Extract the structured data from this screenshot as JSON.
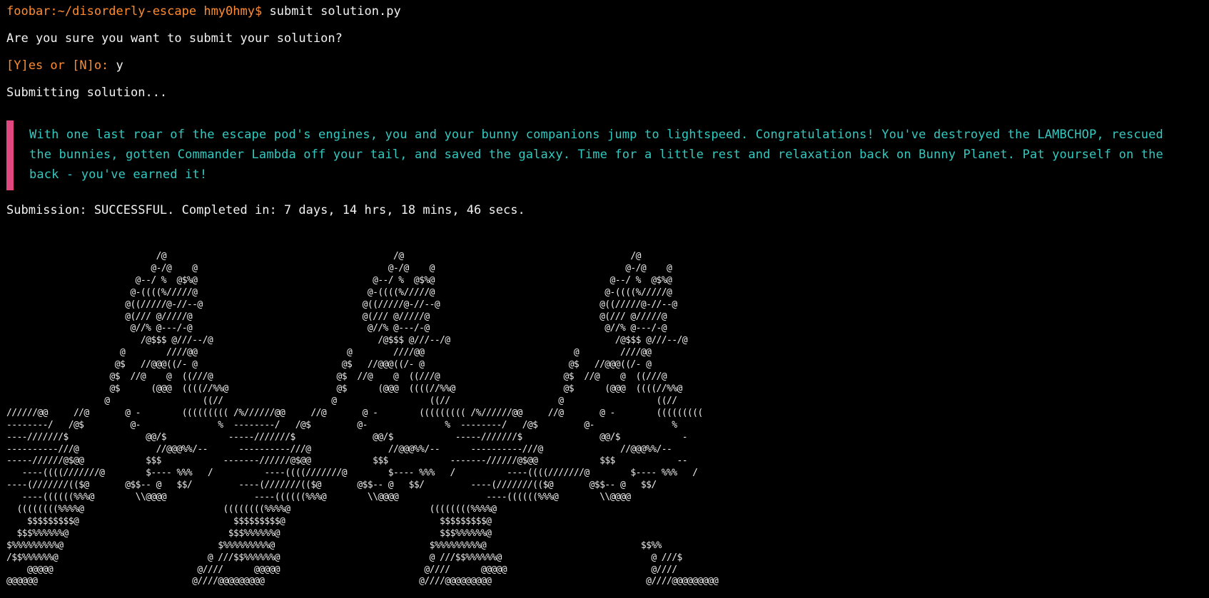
{
  "terminal": {
    "prompt_host_path": "foobar:~/disorderly-escape hmy0hmy$",
    "command": " submit solution.py",
    "confirm_question": "Are you sure you want to submit your solution?",
    "yn_prompt": "[Y]es or [N]o:",
    "yn_answer": " y",
    "submitting": "Submitting solution...",
    "message": "With one last roar of the escape pod's engines, you and your bunny companions jump to lightspeed. Congratulations! You've destroyed the LAMBCHOP, rescued the bunnies, gotten Commander Lambda off your tail, and saved the galaxy. Time for a little rest and relaxation back on Bunny Planet. Pat yourself on the back - you've earned it!",
    "status": "Submission: SUCCESSFUL. Completed in: 7 days, 14 hrs, 18 mins, 46 secs.",
    "ascii_art": "                             /@                                            /@                                            /@\n                            @-/@    @                                     @-/@    @                                     @-/@    @\n                         @--/ %  @$%@                                  @--/ %  @$%@                                  @--/ %  @$%@\n                        @-((((%/////@                                 @-((((%/////@                                 @-((((%/////@\n                       @((/////@-//--@                               @((/////@-//--@                               @((/////@-//--@\n                       @(/// @/////@                                 @(/// @/////@                                 @(/// @/////@\n                        @//% @---/-@                                  @//% @---/-@                                  @//% @---/-@\n                          /@$$$ @///--/@                                /@$$$ @///--/@                                /@$$$ @///--/@\n                      @        ////@@                             @        ////@@                             @        ////@@\n                     @$   //@@@((/- @                            @$   //@@@((/- @                            @$   //@@@((/- @\n                    @$  //@    @  ((///@                        @$  //@    @  ((///@                        @$  //@    @  ((///@\n                    @$      (@@@  ((((//%%@                     @$      (@@@  ((((//%%@                     @$      (@@@  ((((//%%@\n                   @                  ((//                     @                  ((//                     @                  ((//\n//////@@     //@       @ -        ((((((((( /%//////@@     //@       @ -        ((((((((( /%//////@@     //@       @ -        (((((((((\n--------/   /@$         @-               %  --------/   /@$         @-               %  --------/   /@$         @-               %\n----///////$               @@/$            -----///////$               @@/$            -----///////$               @@/$            -\n----------///@               //@@@%%/--      ----------///@               //@@@%%/--      ----------///@               //@@@%%/--\n-----//////@$@@            $$$            -------//////@$@@            $$$            -------//////@$@@            $$$            --\n   ----((((///////@        $---- %%%   /          ----((((///////@        $---- %%%   /          ----((((///////@        $---- %%%   /\n----(///////(($@       @$$-- @   $$/         ----(///////(($@       @$$-- @   $$/         ----(///////(($@       @$$-- @   $$/\n   ----((((((%%%@        \\\\@@@@                 ----((((((%%%@        \\\\@@@@                 ----((((((%%%@        \\\\@@@@\n  ((((((((%%%%@                           ((((((((%%%%@                           ((((((((%%%%@\n    $$$$$$$$$@                              $$$$$$$$$@                              $$$$$$$$$@\n  $$$%%%%%%@                               $$$%%%%%%@                               $$$%%%%%%@\n$%%%%%%%%%@                              $%%%%%%%%%@                              $%%%%%%%%%@                              $$%%\n/$$%%%%%%@                             @ ///$$%%%%%%@                             @ ///$$%%%%%%@                             @ ///$\n    @@@@@                            @////      @@@@@                            @////      @@@@@                            @////\n@@@@@@                              @////@@@@@@@@@                              @////@@@@@@@@@                              @////@@@@@@@@@"
  },
  "colors": {
    "background": "#000000",
    "foreground": "#f2f2f2",
    "prompt": "#ff8c2f",
    "message_text": "#33c9c0",
    "quote_bar": "#e0487f"
  }
}
